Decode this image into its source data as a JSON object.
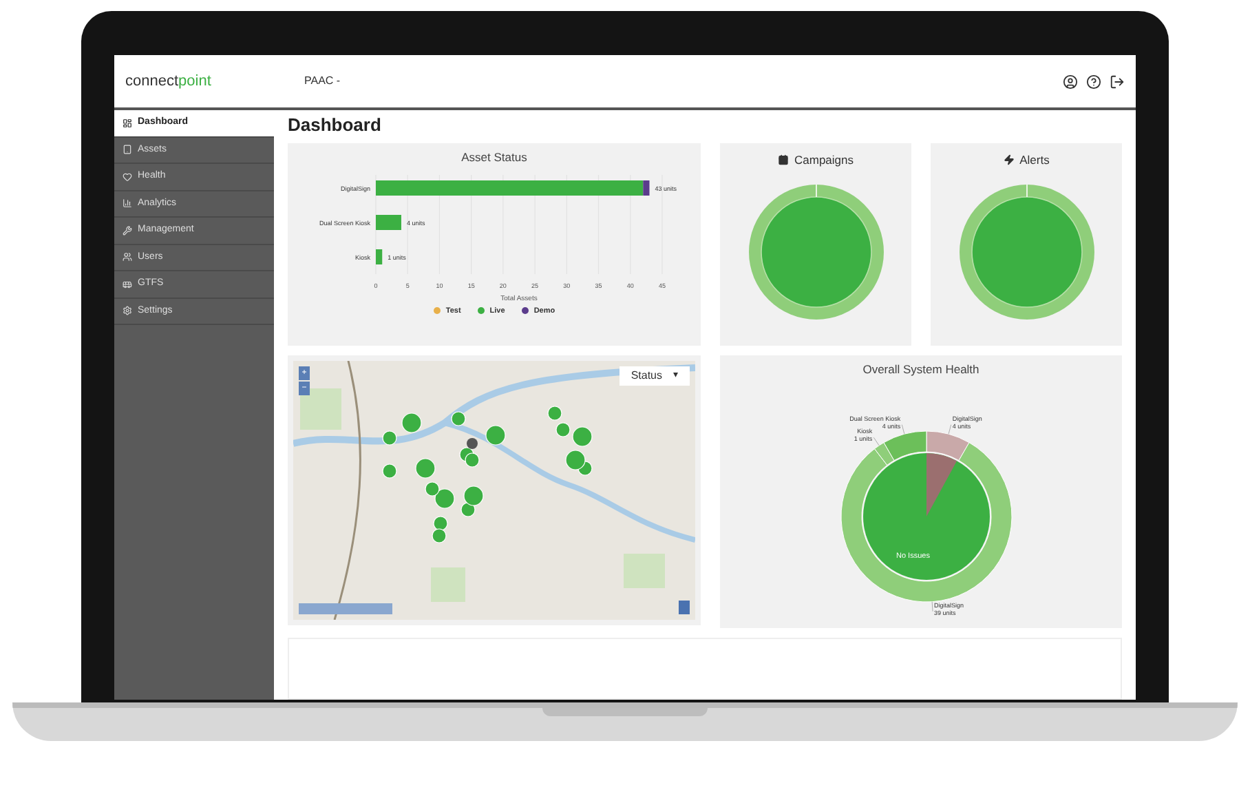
{
  "header": {
    "logo": {
      "first": "connect",
      "second": "point"
    },
    "org_selector": "PAAC -"
  },
  "sidebar": {
    "items": [
      {
        "label": "Dashboard",
        "selected": true
      },
      {
        "label": "Assets",
        "selected": false
      },
      {
        "label": "Health",
        "selected": false
      },
      {
        "label": "Analytics",
        "selected": false
      },
      {
        "label": "Management",
        "selected": false
      },
      {
        "label": "Users",
        "selected": false
      },
      {
        "label": "GTFS",
        "selected": false
      },
      {
        "label": "Settings",
        "selected": false
      }
    ]
  },
  "page_title": "Dashboard",
  "asset_status": {
    "chart_data": {
      "type": "bar",
      "title": "Asset Status",
      "orientation": "horizontal",
      "stacked": true,
      "xlabel": "Total Assets",
      "categories": [
        "DigitalSign",
        "Dual Screen Kiosk",
        "Kiosk"
      ],
      "series": [
        {
          "name": "Test",
          "color": "#e8b04a",
          "values": [
            0,
            0,
            0
          ]
        },
        {
          "name": "Live",
          "color": "#3cb043",
          "values": [
            42,
            4,
            1
          ]
        },
        {
          "name": "Demo",
          "color": "#5b3c8c",
          "values": [
            1,
            0,
            0
          ]
        }
      ],
      "xlim": [
        0,
        45
      ],
      "grid": true,
      "xticks": [
        0,
        5,
        10,
        15,
        20,
        25,
        30,
        35,
        40,
        45
      ],
      "value_labels": [
        "43 units",
        "4 units",
        "1 units"
      ]
    }
  },
  "campaigns": {
    "title": "Campaigns"
  },
  "alerts": {
    "title": "Alerts"
  },
  "map": {
    "layer_select": "Status",
    "layer_caret": "▾",
    "zoom_in": "+",
    "zoom_out": "−"
  },
  "system_health": {
    "chart_data": {
      "type": "donut",
      "title": "Overall System Health",
      "categories": [
        "DigitalSign",
        "DigitalSign",
        "Kiosk",
        "Dual Screen Kiosk"
      ],
      "values": [
        4,
        39,
        1,
        4
      ],
      "colors": [
        "#c9a9a9",
        "#8fce7a",
        "#8fce7a",
        "#6cbf5a"
      ],
      "value_labels": [
        "4 units",
        "39 units",
        "1 units",
        "4 units"
      ]
    },
    "inner_label": "No Issues"
  }
}
